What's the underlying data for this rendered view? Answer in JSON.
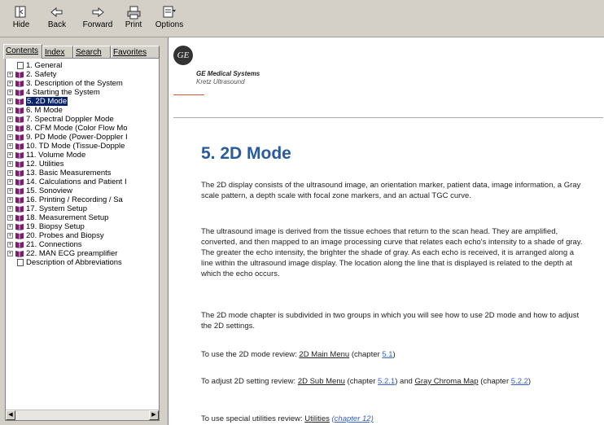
{
  "toolbar": {
    "hide": "Hide",
    "back": "Back",
    "forward": "Forward",
    "print": "Print",
    "options": "Options"
  },
  "tabs": [
    "Contents",
    "Index",
    "Search",
    "Favorites"
  ],
  "tree": [
    {
      "label": "1. General",
      "type": "page"
    },
    {
      "label": "2. Safety",
      "type": "book"
    },
    {
      "label": "3. Description of the System",
      "type": "book"
    },
    {
      "label": "4 Starting the System",
      "type": "book"
    },
    {
      "label": "5. 2D Mode",
      "type": "book",
      "selected": true
    },
    {
      "label": "6. M Mode",
      "type": "book"
    },
    {
      "label": "7. Spectral Doppler Mode",
      "type": "book"
    },
    {
      "label": "8. CFM Mode (Color Flow Mo",
      "type": "book"
    },
    {
      "label": "9. PD Mode (Power-Doppler I",
      "type": "book"
    },
    {
      "label": "10. TD Mode (Tissue-Dopple",
      "type": "book"
    },
    {
      "label": "11. Volume Mode",
      "type": "book"
    },
    {
      "label": "12. Utilities",
      "type": "book"
    },
    {
      "label": "13. Basic Measurements",
      "type": "book"
    },
    {
      "label": "14. Calculations and Patient I",
      "type": "book"
    },
    {
      "label": "15. Sonoview",
      "type": "book"
    },
    {
      "label": "16. Printing / Recording / Sa",
      "type": "book"
    },
    {
      "label": "17. System Setup",
      "type": "book"
    },
    {
      "label": "18. Measurement Setup",
      "type": "book"
    },
    {
      "label": "19. Biopsy Setup",
      "type": "book"
    },
    {
      "label": "20. Probes and Biopsy",
      "type": "book"
    },
    {
      "label": "21. Connections",
      "type": "book"
    },
    {
      "label": "22. MAN ECG preamplifier",
      "type": "book"
    },
    {
      "label": "Description of Abbreviations",
      "type": "page"
    }
  ],
  "content": {
    "logo": "GE",
    "company": "GE Medical Systems",
    "division": "Kretz Ultrasound",
    "title": "5. 2D Mode",
    "p1": "The 2D display consists of the ultrasound image, an orientation marker, patient data, image information, a Gray scale pattern, a depth scale with focal zone markers, and an actual TGC curve.",
    "p2": "The ultrasound image is derived from the tissue echoes that return to the scan head. They are amplified, converted, and then mapped to an image processing curve that relates each echo's intensity to a shade of gray. The greater the echo intensity, the brighter the shade of gray. As each echo is received, it is arranged along a line within the ultrasound image display. The location along the line that is displayed is related to the depth at which the echo occurs.",
    "p3": "The 2D mode chapter is subdivided in two groups in which you will see how to use 2D mode and how to adjust the 2D settings.",
    "p4": {
      "pre": "To use the 2D mode review: ",
      "link": "2D Main Menu",
      "mid": " (chapter ",
      "ref": "5.1",
      "post": ")"
    },
    "p5": {
      "pre": "To adjust 2D setting review: ",
      "link": "2D Sub Menu",
      "mid": " (chapter ",
      "ref": "5.2.1",
      "mid2": ") and ",
      "link2": "Gray Chroma Map",
      "mid3": " (chapter ",
      "ref2": "5.2.2",
      "post": ")"
    },
    "p6": {
      "pre": "To use special utilities review: ",
      "link": "Utilities",
      "ref": "(chapter 12)"
    }
  }
}
